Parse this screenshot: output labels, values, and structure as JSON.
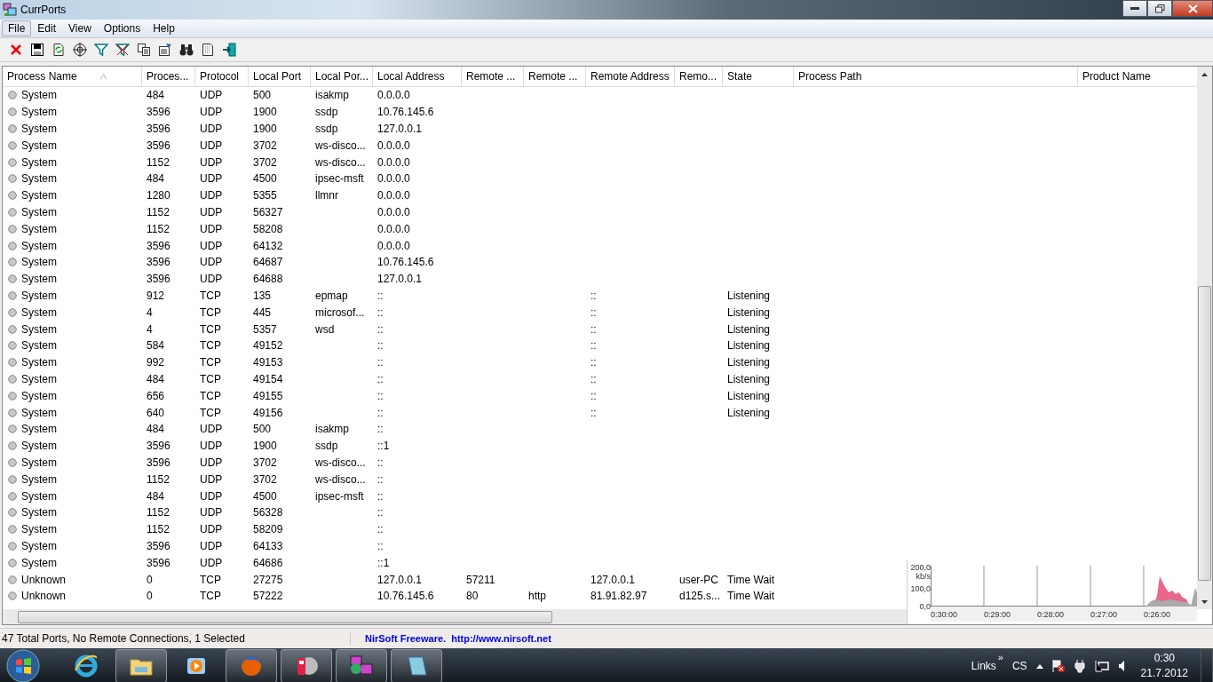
{
  "window": {
    "title": "CurrPorts"
  },
  "menu": [
    {
      "label": "File",
      "selected": true
    },
    {
      "label": "Edit",
      "selected": false
    },
    {
      "label": "View",
      "selected": false
    },
    {
      "label": "Options",
      "selected": false
    },
    {
      "label": "Help",
      "selected": false
    }
  ],
  "toolbar": [
    {
      "kind": "close"
    },
    {
      "kind": "save"
    },
    {
      "kind": "refresh"
    },
    {
      "kind": "target"
    },
    {
      "kind": "filter"
    },
    {
      "kind": "filter-off"
    },
    {
      "kind": "copy"
    },
    {
      "kind": "properties"
    },
    {
      "kind": "binoculars"
    },
    {
      "kind": "report"
    },
    {
      "kind": "exit"
    }
  ],
  "table": {
    "columns": [
      "Process Name",
      "Proces...",
      "Protocol",
      "Local Port",
      "Local Por...",
      "Local Address",
      "Remote ...",
      "Remote ...",
      "Remote Address",
      "Remo...",
      "State",
      "Process Path",
      "Product Name"
    ],
    "rows": [
      [
        "System",
        "484",
        "UDP",
        "500",
        "isakmp",
        "0.0.0.0",
        "",
        "",
        "",
        "",
        ""
      ],
      [
        "System",
        "3596",
        "UDP",
        "1900",
        "ssdp",
        "10.76.145.6",
        "",
        "",
        "",
        "",
        ""
      ],
      [
        "System",
        "3596",
        "UDP",
        "1900",
        "ssdp",
        "127.0.0.1",
        "",
        "",
        "",
        "",
        ""
      ],
      [
        "System",
        "3596",
        "UDP",
        "3702",
        "ws-disco...",
        "0.0.0.0",
        "",
        "",
        "",
        "",
        ""
      ],
      [
        "System",
        "1152",
        "UDP",
        "3702",
        "ws-disco...",
        "0.0.0.0",
        "",
        "",
        "",
        "",
        ""
      ],
      [
        "System",
        "484",
        "UDP",
        "4500",
        "ipsec-msft",
        "0.0.0.0",
        "",
        "",
        "",
        "",
        ""
      ],
      [
        "System",
        "1280",
        "UDP",
        "5355",
        "llmnr",
        "0.0.0.0",
        "",
        "",
        "",
        "",
        ""
      ],
      [
        "System",
        "1152",
        "UDP",
        "56327",
        "",
        "0.0.0.0",
        "",
        "",
        "",
        "",
        ""
      ],
      [
        "System",
        "1152",
        "UDP",
        "58208",
        "",
        "0.0.0.0",
        "",
        "",
        "",
        "",
        ""
      ],
      [
        "System",
        "3596",
        "UDP",
        "64132",
        "",
        "0.0.0.0",
        "",
        "",
        "",
        "",
        ""
      ],
      [
        "System",
        "3596",
        "UDP",
        "64687",
        "",
        "10.76.145.6",
        "",
        "",
        "",
        "",
        ""
      ],
      [
        "System",
        "3596",
        "UDP",
        "64688",
        "",
        "127.0.0.1",
        "",
        "",
        "",
        "",
        ""
      ],
      [
        "System",
        "912",
        "TCP",
        "135",
        "epmap",
        "::",
        "",
        "",
        "::",
        "",
        "Listening"
      ],
      [
        "System",
        "4",
        "TCP",
        "445",
        "microsof...",
        "::",
        "",
        "",
        "::",
        "",
        "Listening"
      ],
      [
        "System",
        "4",
        "TCP",
        "5357",
        "wsd",
        "::",
        "",
        "",
        "::",
        "",
        "Listening"
      ],
      [
        "System",
        "584",
        "TCP",
        "49152",
        "",
        "::",
        "",
        "",
        "::",
        "",
        "Listening"
      ],
      [
        "System",
        "992",
        "TCP",
        "49153",
        "",
        "::",
        "",
        "",
        "::",
        "",
        "Listening"
      ],
      [
        "System",
        "484",
        "TCP",
        "49154",
        "",
        "::",
        "",
        "",
        "::",
        "",
        "Listening"
      ],
      [
        "System",
        "656",
        "TCP",
        "49155",
        "",
        "::",
        "",
        "",
        "::",
        "",
        "Listening"
      ],
      [
        "System",
        "640",
        "TCP",
        "49156",
        "",
        "::",
        "",
        "",
        "::",
        "",
        "Listening"
      ],
      [
        "System",
        "484",
        "UDP",
        "500",
        "isakmp",
        "::",
        "",
        "",
        "",
        "",
        ""
      ],
      [
        "System",
        "3596",
        "UDP",
        "1900",
        "ssdp",
        "::1",
        "",
        "",
        "",
        "",
        ""
      ],
      [
        "System",
        "3596",
        "UDP",
        "3702",
        "ws-disco...",
        "::",
        "",
        "",
        "",
        "",
        ""
      ],
      [
        "System",
        "1152",
        "UDP",
        "3702",
        "ws-disco...",
        "::",
        "",
        "",
        "",
        "",
        ""
      ],
      [
        "System",
        "484",
        "UDP",
        "4500",
        "ipsec-msft",
        "::",
        "",
        "",
        "",
        "",
        ""
      ],
      [
        "System",
        "1152",
        "UDP",
        "56328",
        "",
        "::",
        "",
        "",
        "",
        "",
        ""
      ],
      [
        "System",
        "1152",
        "UDP",
        "58209",
        "",
        "::",
        "",
        "",
        "",
        "",
        ""
      ],
      [
        "System",
        "3596",
        "UDP",
        "64133",
        "",
        "::",
        "",
        "",
        "",
        "",
        ""
      ],
      [
        "System",
        "3596",
        "UDP",
        "64686",
        "",
        "::1",
        "",
        "",
        "",
        "",
        ""
      ],
      [
        "Unknown",
        "0",
        "TCP",
        "27275",
        "",
        "127.0.0.1",
        "57211",
        "",
        "127.0.0.1",
        "user-PC",
        "Time Wait"
      ],
      [
        "Unknown",
        "0",
        "TCP",
        "57222",
        "",
        "10.76.145.6",
        "80",
        "http",
        "81.91.82.97",
        "d125.s...",
        "Time Wait"
      ]
    ]
  },
  "graph": {
    "y_labels": [
      "200,0",
      "kb/s",
      "100,0",
      "0,0"
    ],
    "x_labels": [
      "0:30:00",
      "0:29:00",
      "0:28:00",
      "0:27:00",
      "0:26:00"
    ]
  },
  "status_bar": {
    "summary": "47 Total Ports, No Remote Connections, 1 Selected",
    "credit": "NirSoft Freeware.  http://www.nirsoft.net"
  },
  "taskbar": {
    "apps": [
      {
        "kind": "ie",
        "active": false
      },
      {
        "kind": "folder",
        "active": true
      },
      {
        "kind": "media",
        "active": false
      },
      {
        "kind": "firefox",
        "active": true
      },
      {
        "kind": "phone",
        "active": true
      },
      {
        "kind": "currports",
        "active": true
      },
      {
        "kind": "notepad",
        "active": true
      }
    ],
    "links": "Links",
    "chevron": "»",
    "language": "CS",
    "time": "0:30",
    "date": "21.7.2012"
  }
}
